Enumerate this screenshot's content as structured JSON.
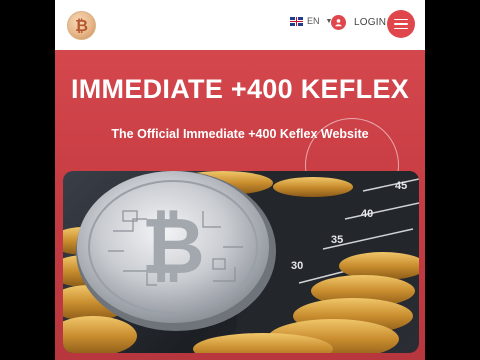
{
  "header": {
    "logo_glyph": "₿",
    "language": "EN",
    "login_label": "LOGIN",
    "icons": {
      "logo": "bitcoin-icon",
      "flag": "uk-flag-icon",
      "caret": "caret-down-icon",
      "user": "user-icon",
      "menu": "hamburger-icon"
    }
  },
  "hero": {
    "title": "IMMEDIATE +400 KEFLEX",
    "subtitle": "The Official Immediate +400 Keflex Website",
    "image_alt": "Silver bitcoin coin on stacks of gold coins",
    "scale_labels": [
      "45",
      "40",
      "35",
      "30"
    ]
  },
  "colors": {
    "accent": "#e0474c",
    "hero_background": "#c83c43",
    "text_on_hero": "#ffffff"
  }
}
